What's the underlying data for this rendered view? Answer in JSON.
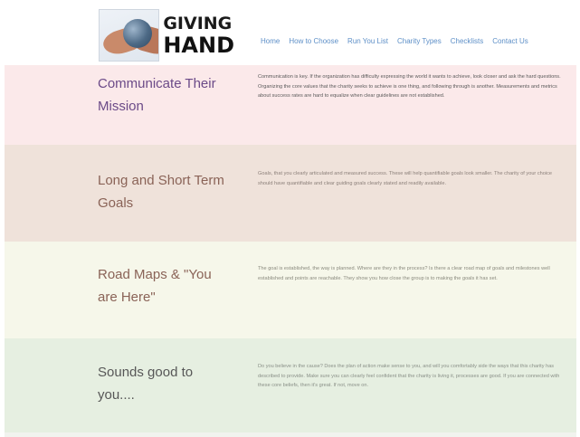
{
  "header": {
    "logo": {
      "line1": "GIVING",
      "line2": "HAND"
    },
    "nav": [
      {
        "label": "Home"
      },
      {
        "label": "How to Choose"
      },
      {
        "label": "Run You List"
      },
      {
        "label": "Charity Types"
      },
      {
        "label": "Checklists"
      },
      {
        "label": "Contact Us"
      }
    ]
  },
  "sections": [
    {
      "title": "Communicate Their Mission",
      "body": "Communication is key. If the organization has difficulty expressing the world it wants to achieve, look closer and ask the hard questions. Organizing the core values that the charity seeks to achieve is one thing, and following through is another. Measurements and metrics about success rates are hard to equalize when clear guidelines are not established."
    },
    {
      "title": "Long and Short Term Goals",
      "body": "Goals, that you clearly articulated and measured success. These will help quantifiable goals look smaller. The charity of your choice should have quantifiable and clear guiding goals clearly stated and readily available."
    },
    {
      "title": "Road Maps & \"You are Here\"",
      "body": "The goal is established, the way is planned. Where are they in the process? Is there a clear road map of goals and milestones well established and points are reachable. They show you how close the group is to making the goals it has set."
    },
    {
      "title": "Sounds good to you....",
      "body": "Do you believe in the cause? Does the plan of action make sense to you, and will you comfortably side the ways that this charity has described to provide. Make sure you can clearly feel confident that the charity is living it, processes are good. If you are connected with these core beliefs, then it's great. If not, move on."
    }
  ]
}
